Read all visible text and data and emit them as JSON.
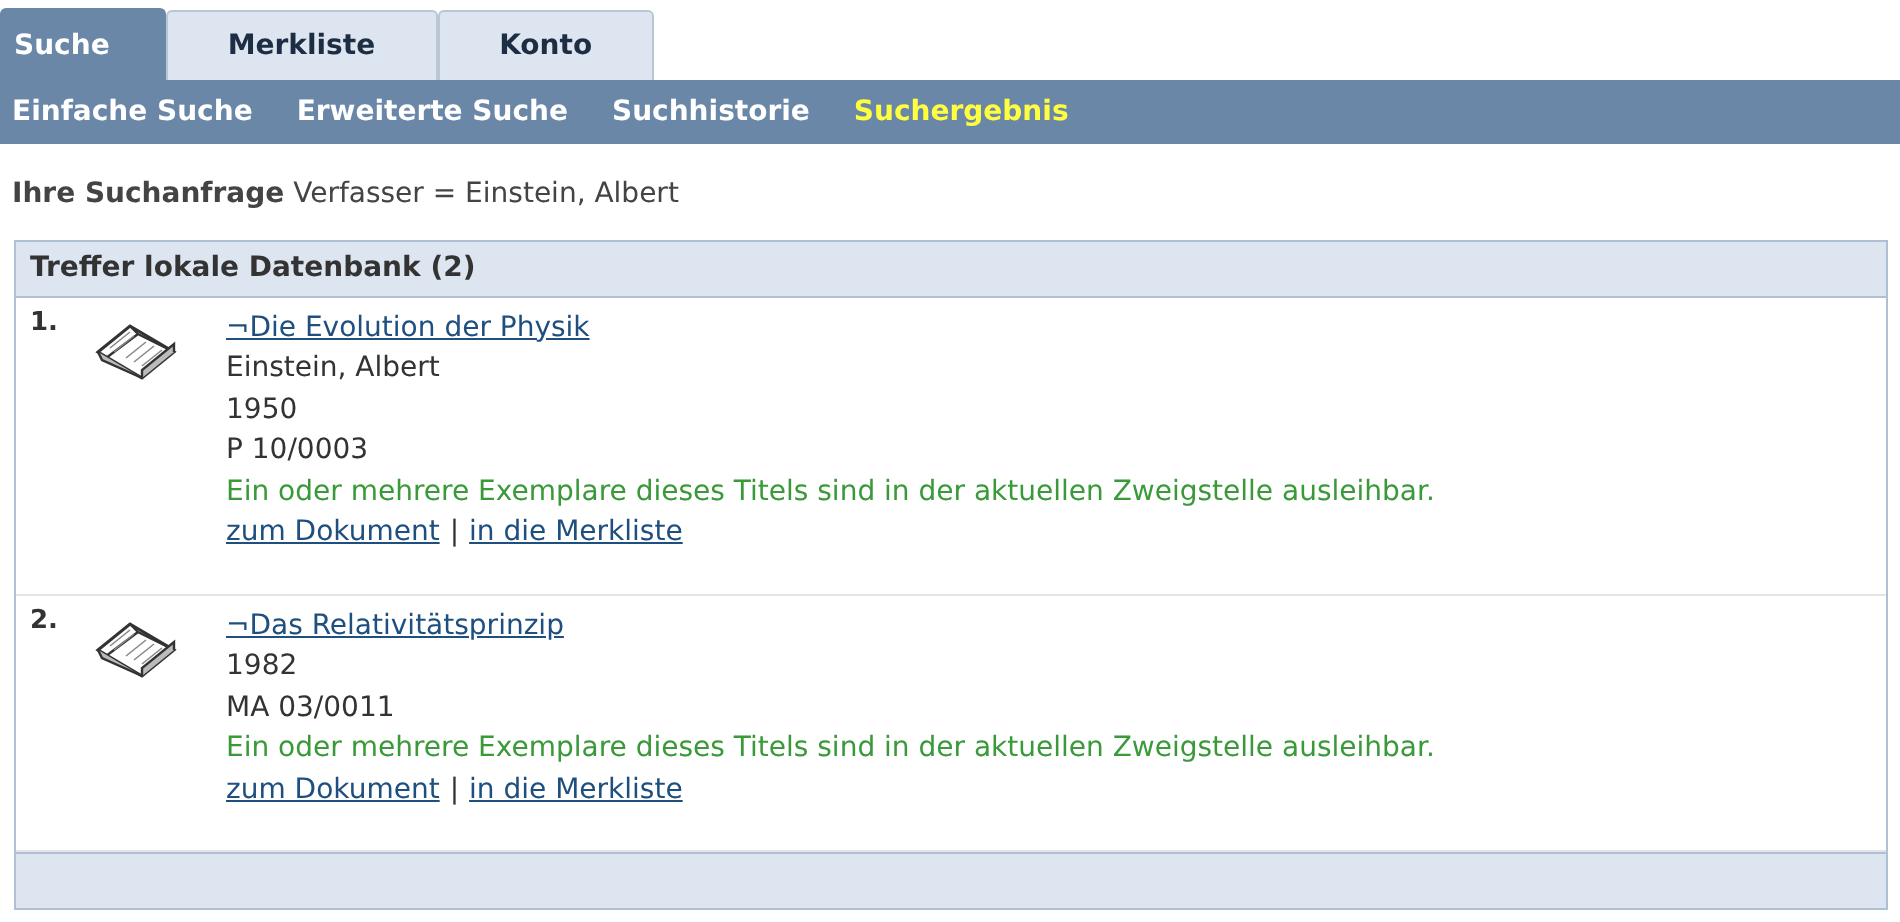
{
  "tabs": [
    {
      "label": "Suche",
      "selected": true
    },
    {
      "label": "Merkliste",
      "selected": false
    },
    {
      "label": "Konto",
      "selected": false
    }
  ],
  "subnav": [
    {
      "label": "Einfache Suche",
      "selected": false
    },
    {
      "label": "Erweiterte Suche",
      "selected": false
    },
    {
      "label": "Suchhistorie",
      "selected": false
    },
    {
      "label": "Suchergebnis",
      "selected": true
    }
  ],
  "query": {
    "label": "Ihre Suchanfrage",
    "value": "Verfasser = Einstein, Albert"
  },
  "results_panel": {
    "title": "Treffer lokale Datenbank (2)",
    "results": [
      {
        "number": "1.",
        "title": "¬Die Evolution der Physik",
        "details": [
          "Einstein, Albert",
          "1950",
          "P 10/0003"
        ],
        "availability": "Ein oder mehrere Exemplare dieses Titels sind in der aktuellen Zweigstelle ausleihbar.",
        "links": [
          "zum Dokument",
          "in die Merkliste"
        ],
        "separator": "|"
      },
      {
        "number": "2.",
        "title": "¬Das Relativitätsprinzip",
        "details": [
          "1982",
          "MA 03/0011"
        ],
        "availability": "Ein oder mehrere Exemplare dieses Titels sind in der aktuellen Zweigstelle ausleihbar.",
        "links": [
          "zum Dokument",
          "in die Merkliste"
        ],
        "separator": "|"
      }
    ]
  }
}
